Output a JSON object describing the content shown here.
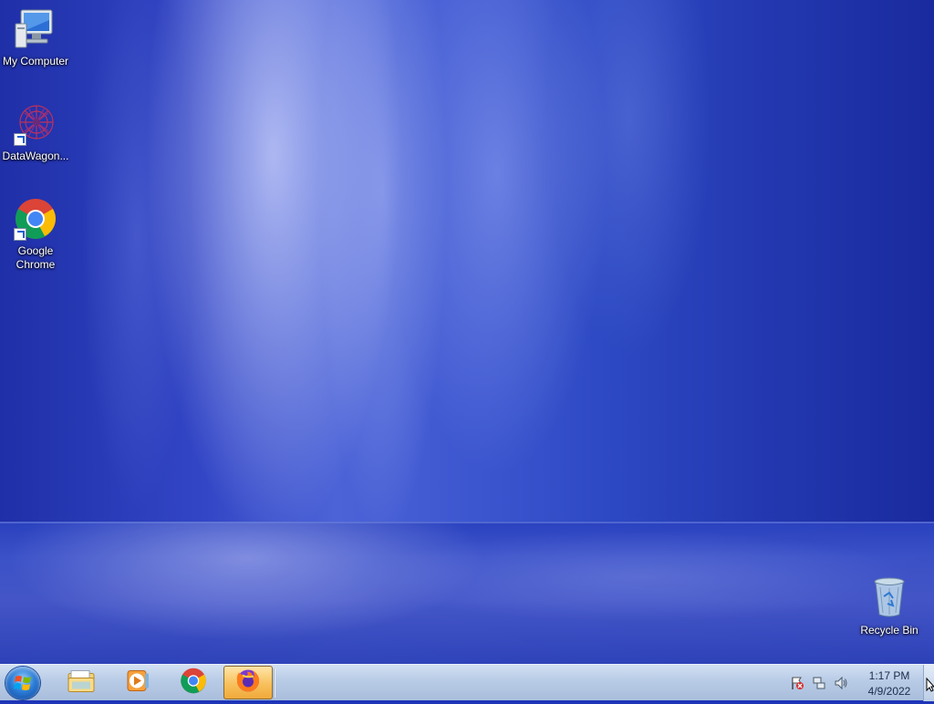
{
  "desktop": {
    "icons": [
      {
        "label": "My Computer",
        "icon": "computer-icon"
      },
      {
        "label": "DataWagon...",
        "icon": "datawagon-icon",
        "shortcut": true
      },
      {
        "label": "Google Chrome",
        "icon": "chrome-icon",
        "shortcut": true
      },
      {
        "label": "Recycle Bin",
        "icon": "recycle-bin-icon"
      }
    ]
  },
  "taskbar": {
    "start": {
      "icon": "windows-logo-icon"
    },
    "pinned": [
      {
        "name": "Windows Explorer",
        "icon": "folder-icon",
        "active": false
      },
      {
        "name": "Windows Media Player",
        "icon": "media-player-icon",
        "active": false
      },
      {
        "name": "Google Chrome",
        "icon": "chrome-icon",
        "active": false
      },
      {
        "name": "Firefox",
        "icon": "firefox-icon",
        "active": true
      }
    ],
    "tray": {
      "icons": [
        "action-center-flag-icon",
        "network-icon",
        "volume-icon"
      ],
      "time": "1:17 PM",
      "date": "4/9/2022"
    }
  },
  "colors": {
    "taskbar": "#b8cbe6",
    "active_button": "#f7c15c",
    "desktop": "#2c48c2"
  }
}
